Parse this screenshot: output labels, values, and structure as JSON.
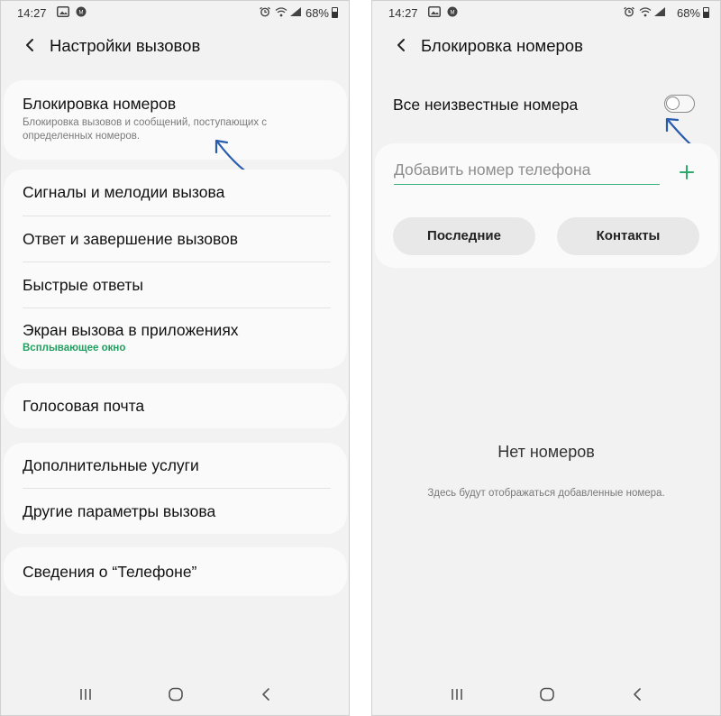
{
  "left_screen": {
    "status": {
      "time": "14:27",
      "battery": "68%"
    },
    "header": {
      "title": "Настройки вызовов"
    },
    "block_card": {
      "title": "Блокировка номеров",
      "subtitle": "Блокировка вызовов и сообщений, поступающих с определенных номеров."
    },
    "group1": {
      "items": [
        {
          "label": "Сигналы и мелодии вызова"
        },
        {
          "label": "Ответ и завершение вызовов"
        },
        {
          "label": "Быстрые ответы"
        },
        {
          "label": "Экран вызова в приложениях",
          "sub": "Всплывающее окно"
        }
      ]
    },
    "voicemail": {
      "label": "Голосовая почта"
    },
    "group3": {
      "items": [
        {
          "label": "Дополнительные услуги"
        },
        {
          "label": "Другие параметры вызова"
        }
      ]
    },
    "about": {
      "label": "Сведения о “Телефоне”"
    }
  },
  "right_screen": {
    "status": {
      "time": "14:27",
      "battery": "68%"
    },
    "header": {
      "title": "Блокировка номеров"
    },
    "unknown_numbers": {
      "label": "Все неизвестные номера",
      "enabled": false
    },
    "add_number": {
      "placeholder": "Добавить номер телефона",
      "value": ""
    },
    "buttons": {
      "recent": "Последние",
      "contacts": "Контакты"
    },
    "empty": {
      "title": "Нет номеров",
      "subtitle": "Здесь будут отображаться добавленные номера."
    }
  },
  "colors": {
    "screen_bg": "#f2f2f2",
    "card_bg": "#fafafa",
    "accent_green": "#20a060",
    "input_underline": "#36b37e",
    "annotation_arrow": "#2a5cad"
  },
  "icons": [
    "back-icon",
    "gallery-icon",
    "notification-icon",
    "alarm-icon",
    "wifi-icon",
    "signal-icon",
    "battery-icon",
    "plus-icon",
    "recents-nav-icon",
    "home-nav-icon",
    "back-nav-icon",
    "annotation-arrow"
  ]
}
